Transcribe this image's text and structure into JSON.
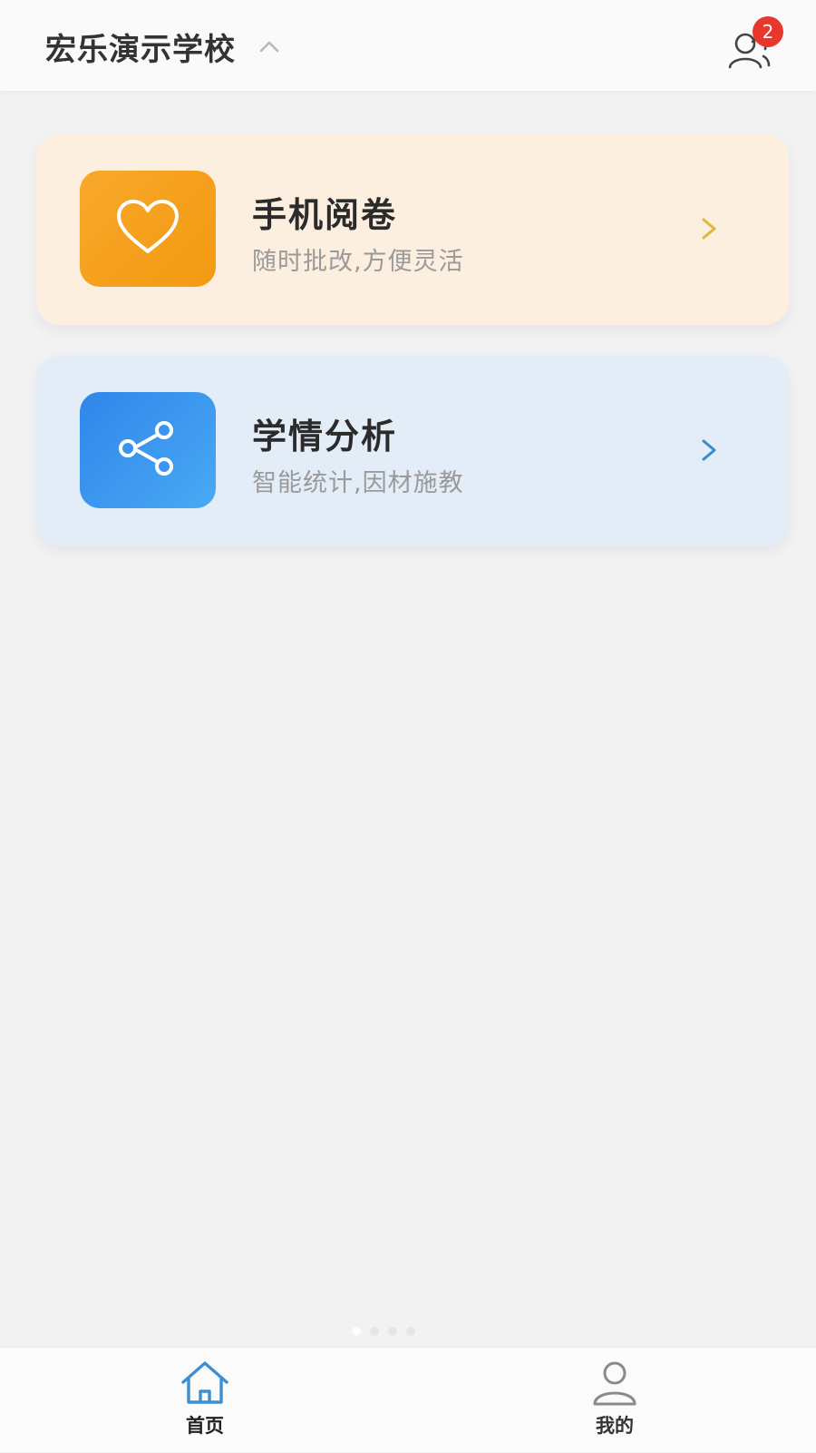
{
  "header": {
    "school_name": "宏乐演示学校",
    "contacts_badge": "2"
  },
  "cards": [
    {
      "title": "手机阅卷",
      "subtitle": "随时批改,方便灵活",
      "icon": "heart-icon",
      "bg_color": "#fcefdf",
      "icon_gradient": [
        "#f8a82a",
        "#f39a12"
      ],
      "chevron_color": "#e0b63c"
    },
    {
      "title": "学情分析",
      "subtitle": "智能统计,因材施教",
      "icon": "share-icon",
      "bg_color": "#e3edf8",
      "icon_gradient": [
        "#2f86ea",
        "#4aa9f4"
      ],
      "chevron_color": "#3a8bc9"
    }
  ],
  "pager": {
    "count": 4,
    "active": 0
  },
  "tabbar": {
    "tabs": [
      {
        "label": "首页",
        "icon": "home-icon",
        "active": true,
        "color": "#3e8fd1"
      },
      {
        "label": "我的",
        "icon": "user-icon",
        "active": false,
        "color": "#8a8a8a"
      }
    ]
  }
}
